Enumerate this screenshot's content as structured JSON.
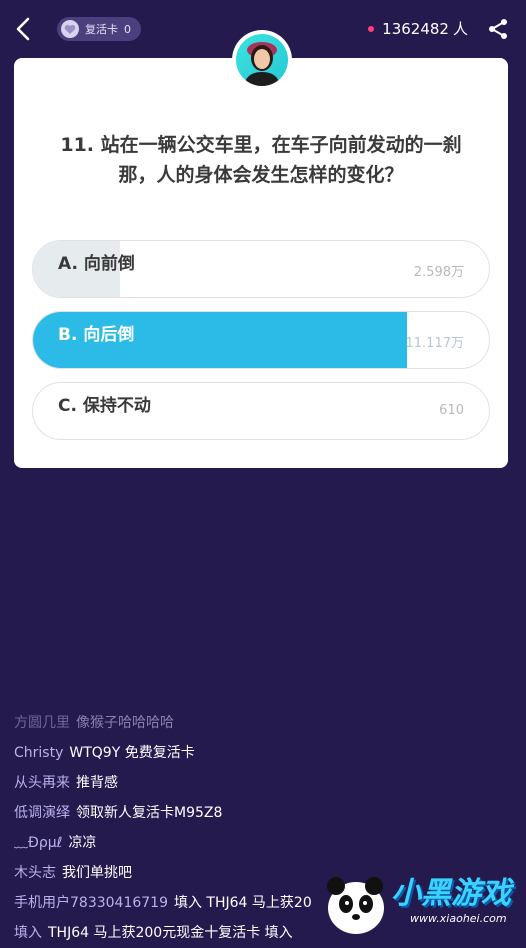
{
  "header": {
    "revive_card_label": "复活卡",
    "revive_card_count": "0",
    "viewer_count": "1362482",
    "viewer_unit": "人"
  },
  "question": {
    "text": "11. 站在一辆公交车里，在车子向前发动的一刹那，人的身体会发生怎样的变化？"
  },
  "options": [
    {
      "label": "A. 向前倒",
      "votes": "2.598万",
      "share": 0.19,
      "selected": false
    },
    {
      "label": "B. 向后倒",
      "votes": "11.117万",
      "share": 0.82,
      "selected": true
    },
    {
      "label": "C. 保持不动",
      "votes": "610",
      "share": 0.0,
      "selected": false
    }
  ],
  "chat": [
    {
      "user": "方圆几里",
      "message": "像猴子哈哈哈哈"
    },
    {
      "user": "Christy",
      "message": "WTQ9Y   免费复活卡"
    },
    {
      "user": "从头再来",
      "message": "推背感"
    },
    {
      "user": "低调演绎",
      "message": "领取新人复活卡M95Z8"
    },
    {
      "user": "﹏Ðρμℓ",
      "message": "凉凉"
    },
    {
      "user": "木头志",
      "message": "我们单挑吧"
    },
    {
      "user": "手机用户78330416719",
      "message": "填入 THJ64    马上获20"
    },
    {
      "user": "填入",
      "message": "THJ64    马上获200元现金十复活卡  填入"
    }
  ],
  "watermark": {
    "title": "小黑游戏",
    "url": "www.xiaohei.com"
  },
  "colors": {
    "background": "#241a4e",
    "selected_fill": "#2bbbe6",
    "other_fill": "#e6ebee",
    "live_dot": "#ff3d7f"
  }
}
